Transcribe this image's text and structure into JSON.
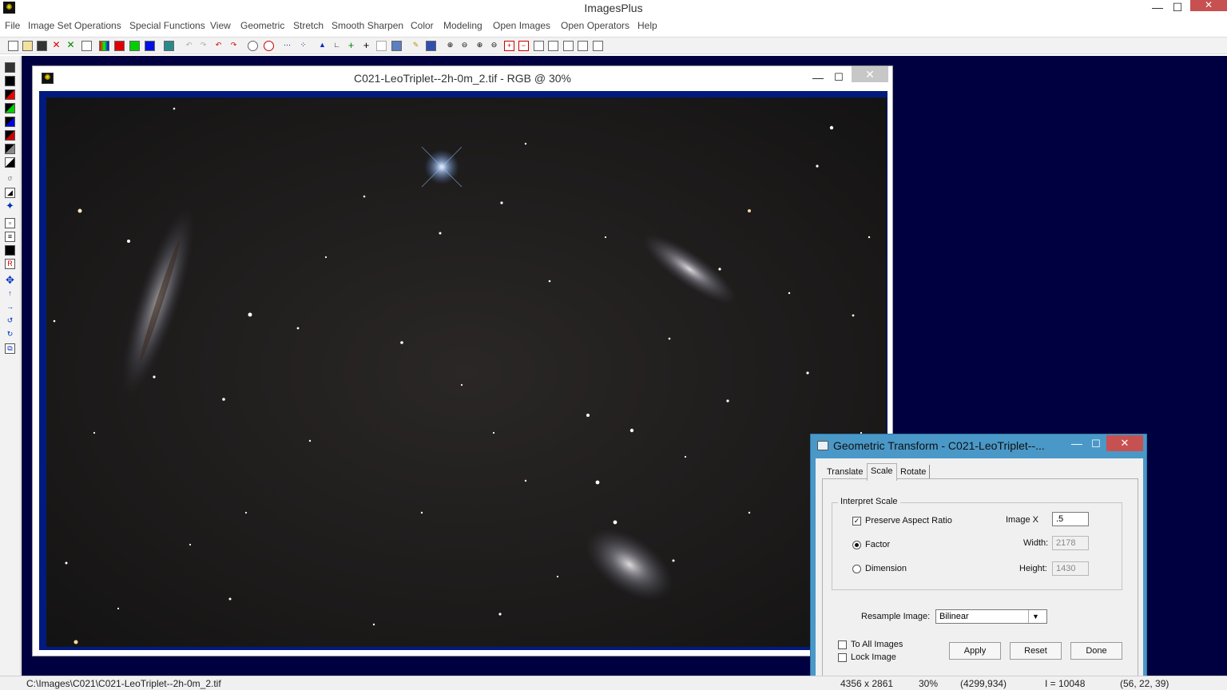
{
  "app": {
    "title": "ImagesPlus",
    "minimize": "—",
    "maximize": "☐",
    "close": "✕"
  },
  "menu": [
    "File",
    "Image Set Operations",
    "Special Functions",
    "View",
    "Geometric",
    "Stretch",
    "Smooth Sharpen",
    "Color",
    "Modeling",
    "Open Images",
    "Open Operators",
    "Help"
  ],
  "toolbar_icons": [
    "new-icon",
    "open-icon",
    "save-icon",
    "close-red-icon",
    "close-green-icon",
    "print-icon",
    "rgb-icon",
    "red-channel-icon",
    "green-channel-icon",
    "blue-channel-icon",
    "grid-icon",
    "undo-gray-icon",
    "redo-gray-icon",
    "undo-icon",
    "redo-icon",
    "target-icon",
    "target-red-icon",
    "dotted-line-icon",
    "chart-icon",
    "triangle-icon",
    "axis-icon",
    "plus-icon",
    "crosshair-icon",
    "box-icon",
    "picture-icon",
    "pencil-icon",
    "grid2-icon",
    "zoom-in-icon",
    "zoom-out-icon",
    "zoom-fit-icon",
    "zoom-actual-icon",
    "add-box-icon",
    "remove-box-icon",
    "square1-icon",
    "square2-icon",
    "square3-icon",
    "square4-icon",
    "square5-icon"
  ],
  "image_window": {
    "title": "C021-LeoTriplet--2h-0m_2.tif - RGB @ 30%",
    "minimize": "—",
    "maximize": "☐",
    "close": "✕"
  },
  "dialog": {
    "title": "Geometric Transform - C021-LeoTriplet--...",
    "minimize": "—",
    "maximize": "☐",
    "close": "✕",
    "tabs": [
      "Translate",
      "Scale",
      "Rotate"
    ],
    "group_label": "Interpret Scale",
    "preserve_aspect": "Preserve Aspect Ratio",
    "preserve_checked": "✓",
    "factor": "Factor",
    "dimension": "Dimension",
    "image_x_label": "Image X",
    "image_x_value": ".5",
    "width_label": "Width:",
    "width_value": "2178",
    "height_label": "Height:",
    "height_value": "1430",
    "resample_label": "Resample Image:",
    "resample_value": "Bilinear",
    "to_all_images": "To All Images",
    "lock_image": "Lock Image",
    "apply": "Apply",
    "reset": "Reset",
    "done": "Done"
  },
  "status": {
    "path": "C:\\Images\\C021\\C021-LeoTriplet--2h-0m_2.tif",
    "size": "4356 x 2861",
    "zoom": "30%",
    "coords": "(4299,934)",
    "value": "I = 10048",
    "rgb": "(56, 22, 39)"
  }
}
